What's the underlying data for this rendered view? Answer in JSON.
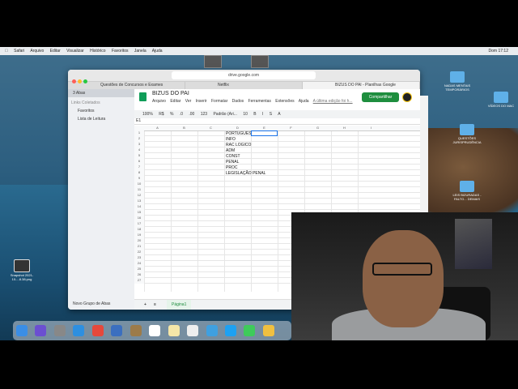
{
  "menubar": {
    "items": [
      "Safari",
      "Arquivo",
      "Editar",
      "Visualizar",
      "Histórico",
      "Favoritos",
      "Janela",
      "Ajuda"
    ],
    "clock": "Dom 17:12"
  },
  "browser": {
    "url": "drive.google.com",
    "tabs": [
      "Questões de Concursos e Exames",
      "Netflix",
      "BIZUS DO PAI - Planilhas Google"
    ],
    "sidebar": {
      "top": "3 Abas",
      "section": "Links Coletados",
      "items": [
        "Favoritos",
        "Lista de Leitura"
      ],
      "footer": "Novo Grupo de Abas"
    }
  },
  "sheet": {
    "title": "BIZUS DO PAI",
    "menu": [
      "Arquivo",
      "Editar",
      "Ver",
      "Inserir",
      "Formatar",
      "Dados",
      "Ferramentas",
      "Extensões",
      "Ajuda"
    ],
    "last_edit": "A última edição foi h...",
    "share_label": "Compartilhar",
    "toolbar": [
      "100%",
      "R$",
      "%",
      ".0",
      ".00",
      "123",
      "Padrão (Ari...",
      "10",
      "B",
      "I",
      "S",
      "A"
    ],
    "name_box": "E1",
    "columns": [
      "A",
      "B",
      "C",
      "D",
      "E",
      "F",
      "G",
      "H",
      "I"
    ],
    "rows": [
      "1",
      "2",
      "3",
      "4",
      "5",
      "6",
      "7",
      "8",
      "9",
      "10",
      "11",
      "12",
      "13",
      "14",
      "15",
      "16",
      "17",
      "18",
      "19",
      "20",
      "21",
      "22",
      "23",
      "24",
      "25",
      "26",
      "27"
    ],
    "cells": [
      "PORTUGUES",
      "INFO",
      "RAC LOGICO",
      "ADM",
      "CONST",
      "PENAL",
      "PROC",
      "LEGISLAÇÃO PENAL"
    ],
    "sheet_tab": "Página1"
  },
  "desktop": {
    "icons": [
      {
        "label": "NADAS MENTAIS TEMPORÁRIOS"
      },
      {
        "label": "VÍDEOS DO MAC"
      },
      {
        "label": "QUESTÕES JURISPRUDÊNCIA"
      },
      {
        "label": "LEIS BIZURADAS - FALTO... DEMAIS"
      },
      {
        "label": "Snapshot 2021-10-...8.38.png"
      }
    ]
  }
}
